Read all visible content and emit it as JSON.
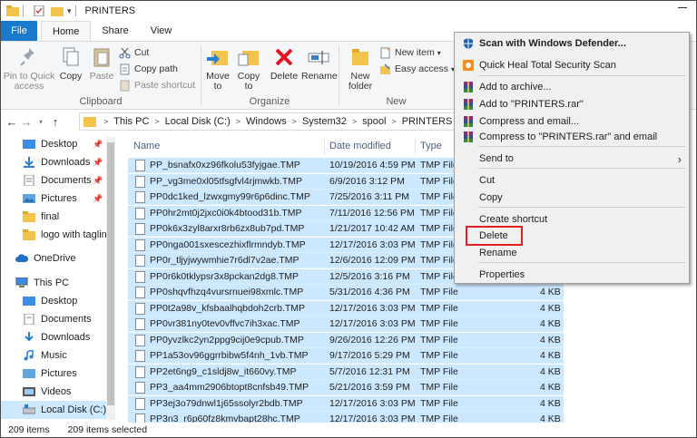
{
  "window": {
    "title": "PRINTERS"
  },
  "ribbon_tabs": [
    "File",
    "Home",
    "Share",
    "View"
  ],
  "clipboard": {
    "pin_label": "Pin to Quick access",
    "copy_label": "Copy",
    "paste_label": "Paste",
    "cut_label": "Cut",
    "copy_path_label": "Copy path",
    "paste_shortcut_label": "Paste shortcut",
    "group_label": "Clipboard"
  },
  "organize": {
    "move_to_label": "Move to",
    "copy_to_label": "Copy to",
    "delete_label": "Delete",
    "rename_label": "Rename",
    "group_label": "Organize"
  },
  "new_group": {
    "new_folder_label": "New folder",
    "new_item_label": "New item",
    "easy_access_label": "Easy access",
    "group_label": "New"
  },
  "breadcrumb": [
    "This PC",
    "Local Disk (C:)",
    "Windows",
    "System32",
    "spool",
    "PRINTERS"
  ],
  "nav_pane": {
    "quick_items": [
      {
        "label": "Desktop",
        "icon": "desktop-icon",
        "pinned": true
      },
      {
        "label": "Downloads",
        "icon": "downloads-icon",
        "pinned": true
      },
      {
        "label": "Documents",
        "icon": "documents-icon",
        "pinned": true
      },
      {
        "label": "Pictures",
        "icon": "pictures-icon",
        "pinned": true
      },
      {
        "label": "final",
        "icon": "folder-icon",
        "pinned": false
      },
      {
        "label": "logo with tagline",
        "icon": "folder-icon",
        "pinned": false
      }
    ],
    "onedrive_label": "OneDrive",
    "this_pc_label": "This PC",
    "pc_items": [
      {
        "label": "Desktop",
        "icon": "desktop-icon"
      },
      {
        "label": "Documents",
        "icon": "documents-icon"
      },
      {
        "label": "Downloads",
        "icon": "downloads-icon"
      },
      {
        "label": "Music",
        "icon": "music-icon"
      },
      {
        "label": "Pictures",
        "icon": "pictures-icon"
      },
      {
        "label": "Videos",
        "icon": "videos-icon"
      },
      {
        "label": "Local Disk (C:)",
        "icon": "drive-icon"
      }
    ]
  },
  "columns": {
    "name": "Name",
    "date": "Date modified",
    "type": "Type"
  },
  "files": [
    {
      "name": "PP_bsnafx0xz96fkolu53fyjgae.TMP",
      "date": "10/19/2016 4:59 PM",
      "type": "TMP File",
      "size": ""
    },
    {
      "name": "PP_vg3me0xl05tfsgfvl4rjmwkb.TMP",
      "date": "6/9/2016 3:12 PM",
      "type": "TMP File",
      "size": ""
    },
    {
      "name": "PP0dc1ked_lzwxgmy99r6p6dinc.TMP",
      "date": "7/25/2016 3:11 PM",
      "type": "TMP File",
      "size": ""
    },
    {
      "name": "PP0hr2mt0j2jxc0i0k4btood31b.TMP",
      "date": "7/11/2016 12:56 PM",
      "type": "TMP File",
      "size": ""
    },
    {
      "name": "PP0k6x3zyl8arxr8rb6zx8ub7pd.TMP",
      "date": "1/21/2017 10:42 AM",
      "type": "TMP File",
      "size": ""
    },
    {
      "name": "PP0nga001sxescezhixflrmndyb.TMP",
      "date": "12/17/2016 3:03 PM",
      "type": "TMP File",
      "size": ""
    },
    {
      "name": "PP0r_tljyjwywmhie7r6dl7v2ae.TMP",
      "date": "12/6/2016 12:09 PM",
      "type": "TMP File",
      "size": ""
    },
    {
      "name": "PP0r6k0tklypsr3x8pckan2dg8.TMP",
      "date": "12/5/2016 3:16 PM",
      "type": "TMP File",
      "size": ""
    },
    {
      "name": "PP0shqvfhzq4vursrnuei98xmlc.TMP",
      "date": "5/31/2016 4:36 PM",
      "type": "TMP File",
      "size": "4 KB"
    },
    {
      "name": "PP0t2a98v_kfsbaalhqbdoh2crb.TMP",
      "date": "12/17/2016 3:03 PM",
      "type": "TMP File",
      "size": "4 KB"
    },
    {
      "name": "PP0vr381ny0tev0vffvc7ih3xac.TMP",
      "date": "12/17/2016 3:03 PM",
      "type": "TMP File",
      "size": "4 KB"
    },
    {
      "name": "PP0yvzlkc2yn2ppg9cij0e9cpub.TMP",
      "date": "9/26/2016 12:26 PM",
      "type": "TMP File",
      "size": "4 KB"
    },
    {
      "name": "PP1a53ov96ggrrbibw5f4nh_1vb.TMP",
      "date": "9/17/2016 5:29 PM",
      "type": "TMP File",
      "size": "4 KB"
    },
    {
      "name": "PP2et6ng9_c1sldj8w_it660vy.TMP",
      "date": "5/7/2016 12:31 PM",
      "type": "TMP File",
      "size": "4 KB"
    },
    {
      "name": "PP3_aa4mm2906btopt8cnfsb49.TMP",
      "date": "5/21/2016 3:59 PM",
      "type": "TMP File",
      "size": "4 KB"
    },
    {
      "name": "PP3ej3o79dnwl1j65ssolyr2bdb.TMP",
      "date": "12/17/2016 3:03 PM",
      "type": "TMP File",
      "size": "4 KB"
    },
    {
      "name": "PP3n3_r6p60fz8kmvbapt28hc.TMP",
      "date": "12/17/2016 3:03 PM",
      "type": "TMP File",
      "size": "4 KB"
    }
  ],
  "status": {
    "item_count": "209 items",
    "selected": "209 items selected"
  },
  "context_menu": {
    "items": [
      {
        "label": "Scan with Windows Defender...",
        "icon": "windows-defender-icon",
        "bold": true
      },
      {
        "label": "Quick Heal Total Security Scan",
        "icon": "quick-heal-icon"
      },
      {
        "label": "Add to archive...",
        "icon": "winrar-icon"
      },
      {
        "label": "Add to \"PRINTERS.rar\"",
        "icon": "winrar-icon"
      },
      {
        "label": "Compress and email...",
        "icon": "winrar-icon"
      },
      {
        "label": "Compress to \"PRINTERS.rar\" and email",
        "icon": "winrar-icon"
      },
      {
        "label": "Send to",
        "submenu": true
      },
      {
        "label": "Cut"
      },
      {
        "label": "Copy"
      },
      {
        "label": "Create shortcut"
      },
      {
        "label": "Delete",
        "highlighted": true
      },
      {
        "label": "Rename"
      },
      {
        "label": "Properties"
      }
    ],
    "highlight_color": "#e02020"
  },
  "colors": {
    "accent": "#1979ca",
    "selection": "#cce8ff",
    "folder": "#f3c44c",
    "delete_red": "#e81123"
  }
}
